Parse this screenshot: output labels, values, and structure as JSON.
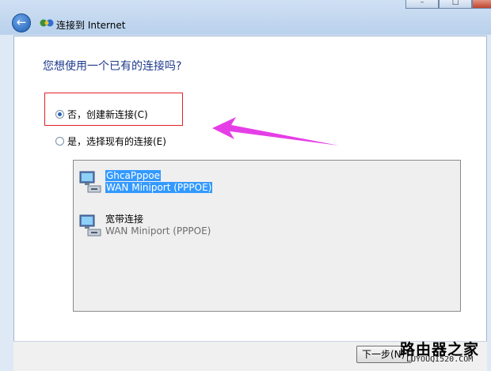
{
  "window": {
    "title": "连接到 Internet",
    "controls": {
      "minimize": "–",
      "maximize": "□",
      "close": "✕"
    }
  },
  "nav": {
    "back_icon": "back-arrow-icon"
  },
  "dialog": {
    "question": "您想使用一个已有的连接吗?",
    "options": [
      {
        "label": "否，创建新连接(C)",
        "selected": true
      },
      {
        "label": "是，选择现有的连接(E)",
        "selected": false
      }
    ],
    "connections": [
      {
        "name": "GhcaPppoe",
        "device": "WAN Miniport (PPPOE)",
        "selected": true
      },
      {
        "name": "宽带连接",
        "device": "WAN Miniport (PPPOE)",
        "selected": false
      }
    ]
  },
  "footer": {
    "next_label": "下一步(N)"
  },
  "watermark": {
    "brand": "路由器之家",
    "url": "LUYOUQI520.COM"
  },
  "colors": {
    "highlight_box": "#e3212a",
    "arrow": "#e63ee6",
    "selection": "#3399ff"
  }
}
